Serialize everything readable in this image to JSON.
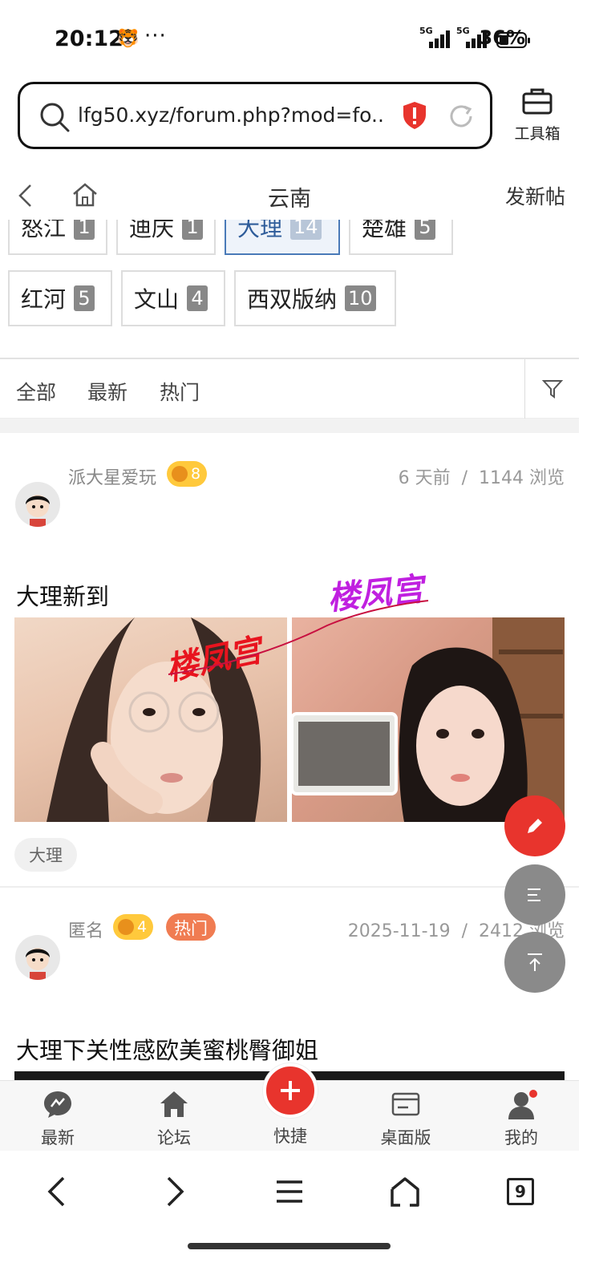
{
  "status_bar": {
    "time": "20:12",
    "extra_dots": "···",
    "signal1_label": "5G",
    "signal2_label": "5G",
    "battery_percent": "36%",
    "battery_level": 0.36
  },
  "browser": {
    "url": "lfg50.xyz/forum.php?mod=fo...",
    "toolbox_label": "工具箱",
    "tab_count": "9"
  },
  "forum_nav": {
    "title": "云南",
    "new_post_label": "发新帖"
  },
  "region_tags": [
    {
      "name": "怒江",
      "count": "1",
      "selected": false
    },
    {
      "name": "迪庆",
      "count": "1",
      "selected": false
    },
    {
      "name": "大理",
      "count": "14",
      "selected": true
    },
    {
      "name": "楚雄",
      "count": "5",
      "selected": false
    },
    {
      "name": "红河",
      "count": "5",
      "selected": false
    },
    {
      "name": "文山",
      "count": "4",
      "selected": false
    },
    {
      "name": "西双版纳",
      "count": "10",
      "selected": false
    }
  ],
  "filter_tabs": [
    "全部",
    "最新",
    "热门"
  ],
  "posts": [
    {
      "author": "派大星爱玩",
      "level": "8",
      "meta_time": "6 天前",
      "meta_sep": "/",
      "meta_views": "1144 浏览",
      "title": "大理新到",
      "tag": "大理",
      "watermark": "楼凤宫"
    },
    {
      "author": "匿名",
      "level": "4",
      "hot_badge": "热门",
      "meta_time": "2025-11-19",
      "meta_sep": "/",
      "meta_views": "2412 浏览",
      "title": "大理下关性感欧美蜜桃臀御姐"
    }
  ],
  "app_nav": [
    {
      "label": "最新",
      "icon": "chat-bubble-icon"
    },
    {
      "label": "论坛",
      "icon": "home-icon"
    },
    {
      "label": "快捷",
      "icon": "plus-icon"
    },
    {
      "label": "桌面版",
      "icon": "desktop-card-icon"
    },
    {
      "label": "我的",
      "icon": "user-icon"
    }
  ],
  "colors": {
    "accent_red": "#e8342d",
    "selected_tag_blue": "#2e5c9a",
    "level_badge": "#ffc93c",
    "hot_badge": "#f07c52",
    "fab_gray": "#8a8a8a"
  }
}
